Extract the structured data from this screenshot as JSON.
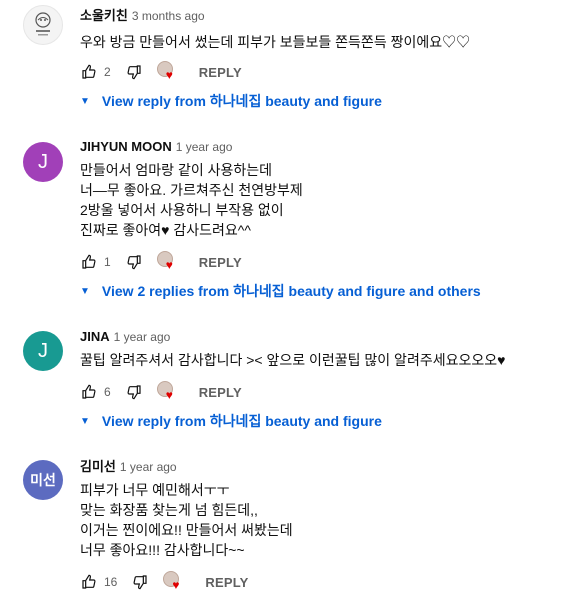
{
  "comments": [
    {
      "author": "소울키친",
      "time": "3 months ago",
      "avatar_text": "",
      "avatar_color": "#f4f4f4",
      "text": "우와 방금 만들어서 썼는데 피부가 보들보들 쫀득쫀득 짱이에요♡♡",
      "likes": "2",
      "reply_label": "REPLY",
      "view_replies": "View reply from 하나네집 beauty and figure"
    },
    {
      "author": "JIHYUN MOON",
      "time": "1 year ago",
      "avatar_text": "J",
      "avatar_color": "#a140b8",
      "text": "만들어서 엄마랑 같이 사용하는데\n너—무 좋아요. 가르쳐주신 천연방부제\n2방울 넣어서 사용하니 부작용 없이\n진짜로 좋아여♥ 감사드려요^^",
      "likes": "1",
      "reply_label": "REPLY",
      "view_replies": "View 2 replies from 하나네집 beauty and figure and others"
    },
    {
      "author": "JINA",
      "time": "1 year ago",
      "avatar_text": "J",
      "avatar_color": "#189a92",
      "text": "꿀팁 알려주셔서 감사합니다 >< 앞으로 이런꿀팁 많이 알려주세요오오오♥",
      "likes": "6",
      "reply_label": "REPLY",
      "view_replies": "View reply from 하나네집 beauty and figure"
    },
    {
      "author": "김미선",
      "time": "1 year ago",
      "avatar_text": "미선",
      "avatar_color": "#5c6bc0",
      "text": "피부가 너무 예민해서ㅜㅜ\n맞는 화장품 찾는게 넘 힘든데,,\n이거는 찐이에요!! 만들어서 써봤는데\n너무 좋아요!!! 감사합니다~~",
      "likes": "16",
      "reply_label": "REPLY",
      "view_replies": ""
    }
  ],
  "colors": {
    "link": "#065fd4",
    "secondary": "#606060",
    "heart": "#e00000"
  },
  "icons": {
    "like": "thumb-up-icon",
    "dislike": "thumb-down-icon",
    "creator_heart": "creator-heart-icon",
    "expand": "caret-down-icon"
  }
}
